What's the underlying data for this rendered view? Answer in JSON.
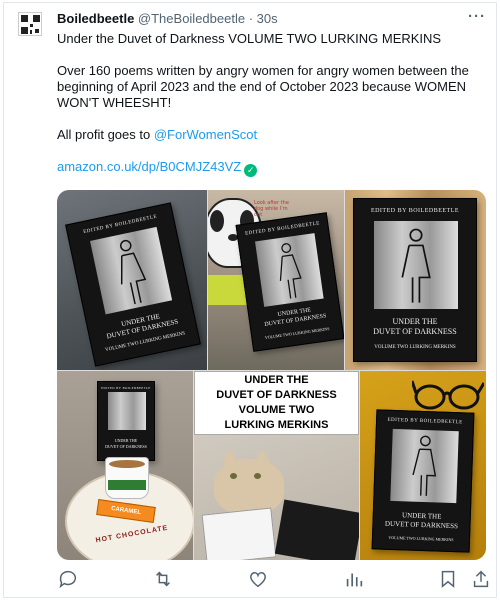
{
  "tweet": {
    "display_name": "Boiledbeetle",
    "handle": "@TheBoiledbeetle",
    "separator": "·",
    "time": "30s",
    "more_icon": "more-horizontal-icon",
    "line1": "Under the Duvet of Darkness VOLUME TWO LURKING MERKINS",
    "line2": "Over 160 poems written by angry women for angry women between the beginning of April 2023 and the end of October 2023 because WOMEN WON'T WHEESHT!",
    "profit_prefix": "All profit goes to ",
    "mention": "@ForWomenScot",
    "url": "amazon.co.uk/dp/B0CMJZ43VZ",
    "verified_icon": "check-circle-icon"
  },
  "media": {
    "book_edited_by": "EDITED BY BOILEDBEETLE",
    "book_title_1": "UNDER THE",
    "book_title_2": "DUVET OF DARKNESS",
    "book_subtitle": "VOLUME TWO LURKING MERKINS",
    "mug_label": "CARAMEL",
    "note_text": "Look after the dog while I’m out",
    "overlay_line1": "UNDER THE",
    "overlay_line2": "DUVET OF DARKNESS",
    "overlay_line3": "VOLUME TWO",
    "overlay_line4": "LURKING MERKINS",
    "plate_text": "HOT CHOCOLATE"
  },
  "actions": [
    "reply-icon",
    "retweet-icon",
    "like-icon",
    "views-icon",
    "bookmark-icon",
    "share-icon"
  ],
  "colors": {
    "accent": "#1d9bf0",
    "verified": "#00ba7c",
    "muted": "#536471"
  }
}
